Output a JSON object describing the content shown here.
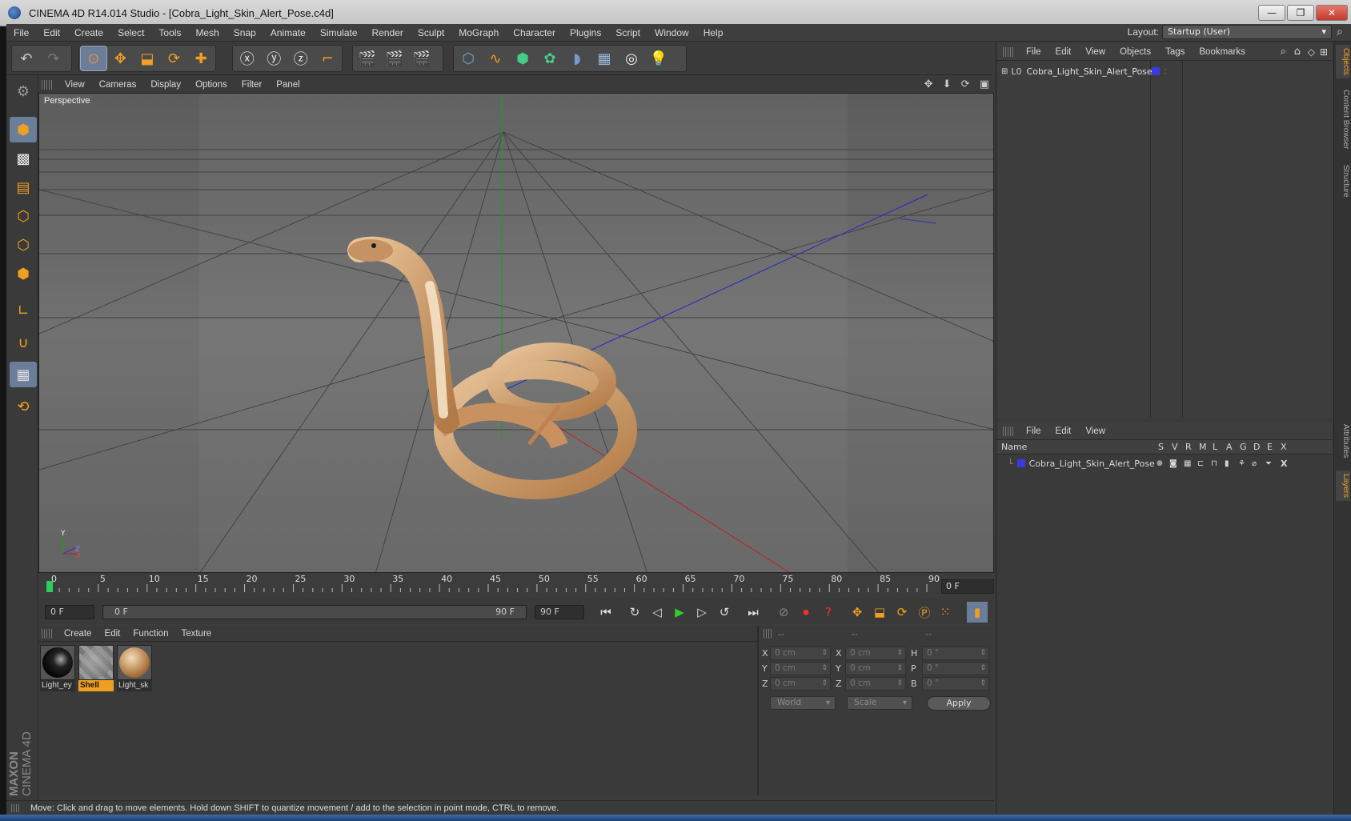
{
  "window": {
    "title": "CINEMA 4D R14.014 Studio - [Cobra_Light_Skin_Alert_Pose.c4d]",
    "buttons": {
      "minimize": "—",
      "restore": "❐",
      "close": "✕"
    }
  },
  "menubar": {
    "items": [
      "File",
      "Edit",
      "Create",
      "Select",
      "Tools",
      "Mesh",
      "Snap",
      "Animate",
      "Simulate",
      "Render",
      "Sculpt",
      "MoGraph",
      "Character",
      "Plugins",
      "Script",
      "Window",
      "Help"
    ],
    "layout_label": "Layout:",
    "layout_value": "Startup (User)"
  },
  "viewport": {
    "menu": [
      "View",
      "Cameras",
      "Display",
      "Options",
      "Filter",
      "Panel"
    ],
    "label": "Perspective",
    "nav_icons": "✥ ⬇ ⟳ ▣"
  },
  "timeline": {
    "ticks": [
      "0",
      "5",
      "10",
      "15",
      "20",
      "25",
      "30",
      "35",
      "40",
      "45",
      "50",
      "55",
      "60",
      "65",
      "70",
      "75",
      "80",
      "85",
      "90"
    ],
    "current_frame": "0 F"
  },
  "transport": {
    "start_field": "0 F",
    "range_start": "0 F",
    "range_end": "90 F",
    "end_field": "90 F"
  },
  "materials": {
    "menu": [
      "Create",
      "Edit",
      "Function",
      "Texture"
    ],
    "items": [
      {
        "name": "Light_ey"
      },
      {
        "name": "Shell"
      },
      {
        "name": "Light_sk"
      }
    ]
  },
  "coordinates": {
    "headers": [
      "--",
      "--",
      "--"
    ],
    "rows": [
      {
        "pos_label": "X",
        "pos": "0 cm",
        "size_label": "X",
        "size": "0 cm",
        "rot_label": "H",
        "rot": "0 °"
      },
      {
        "pos_label": "Y",
        "pos": "0 cm",
        "size_label": "Y",
        "size": "0 cm",
        "rot_label": "P",
        "rot": "0 °"
      },
      {
        "pos_label": "Z",
        "pos": "0 cm",
        "size_label": "Z",
        "size": "0 cm",
        "rot_label": "B",
        "rot": "0 °"
      }
    ],
    "mode": "World",
    "transform": "Scale",
    "apply": "Apply"
  },
  "status": {
    "text": "Move: Click and drag to move elements. Hold down SHIFT to quantize movement / add to the selection in point mode, CTRL to remove."
  },
  "objects_panel": {
    "menu": [
      "File",
      "Edit",
      "View",
      "Objects",
      "Tags",
      "Bookmarks"
    ],
    "object_name": "Cobra_Light_Skin_Alert_Pose"
  },
  "layers_panel": {
    "menu": [
      "File",
      "Edit",
      "View"
    ],
    "column_name": "Name",
    "flags": [
      "S",
      "V",
      "R",
      "M",
      "L",
      "A",
      "G",
      "D",
      "E",
      "X"
    ],
    "layer_name": "Cobra_Light_Skin_Alert_Pose"
  },
  "side_tabs": [
    "Objects",
    "Content Browser",
    "Structure",
    "Attributes",
    "Layers"
  ],
  "brand": {
    "maxon": "MAXON",
    "product": "CINEMA 4D"
  },
  "colors": {
    "accent": "#f0a020",
    "selection": "#6a7e9a",
    "layer_color": "#3a3ae0"
  }
}
